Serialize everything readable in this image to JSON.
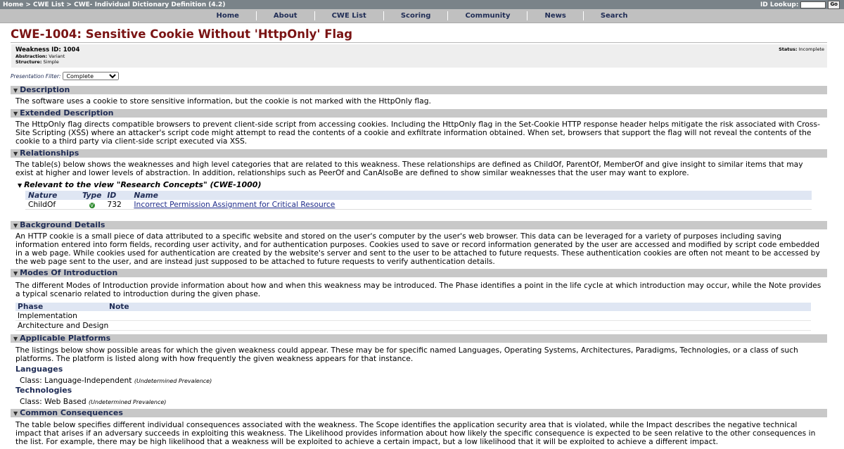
{
  "breadcrumb": "Home > CWE List > CWE- Individual Dictionary Definition (4.2)",
  "id_lookup": {
    "label": "ID Lookup:",
    "value": "",
    "go": "Go"
  },
  "nav": [
    "Home",
    "About",
    "CWE List",
    "Scoring",
    "Community",
    "News",
    "Search"
  ],
  "title": "CWE-1004: Sensitive Cookie Without 'HttpOnly' Flag",
  "weakness": {
    "id": "Weakness ID: 1004",
    "abstraction_label": "Abstraction:",
    "abstraction": "Variant",
    "structure_label": "Structure:",
    "structure": "Simple",
    "status_label": "Status:",
    "status": "Incomplete"
  },
  "filter": {
    "label": "Presentation Filter:",
    "value": "Complete",
    "options": [
      "Complete"
    ]
  },
  "sections": {
    "description": {
      "title": "Description",
      "text": "The software uses a cookie to store sensitive information, but the cookie is not marked with the HttpOnly flag."
    },
    "extended": {
      "title": "Extended Description",
      "text": "The HttpOnly flag directs compatible browsers to prevent client-side script from accessing cookies. Including the HttpOnly flag in the Set-Cookie HTTP response header helps mitigate the risk associated with Cross-Site Scripting (XSS) where an attacker's script code might attempt to read the contents of a cookie and exfiltrate information obtained. When set, browsers that support the flag will not reveal the contents of the cookie to a third party via client-side script executed via XSS."
    },
    "relationships": {
      "title": "Relationships",
      "text": "The table(s) below shows the weaknesses and high level categories that are related to this weakness. These relationships are defined as ChildOf, ParentOf, MemberOf and give insight to similar items that may exist at higher and lower levels of abstraction. In addition, relationships such as PeerOf and CanAlsoBe are defined to show similar weaknesses that the user may want to explore.",
      "view_title": "Relevant to the view \"Research Concepts\" (CWE-1000)",
      "columns": [
        "Nature",
        "Type",
        "ID",
        "Name"
      ],
      "rows": [
        {
          "nature": "ChildOf",
          "type": "V",
          "id": "732",
          "name": "Incorrect Permission Assignment for Critical Resource"
        }
      ]
    },
    "background": {
      "title": "Background Details",
      "text": "An HTTP cookie is a small piece of data attributed to a specific website and stored on the user's computer by the user's web browser. This data can be leveraged for a variety of purposes including saving information entered into form fields, recording user activity, and for authentication purposes. Cookies used to save or record information generated by the user are accessed and modified by script code embedded in a web page. While cookies used for authentication are created by the website's server and sent to the user to be attached to future requests. These authentication cookies are often not meant to be accessed by the web page sent to the user, and are instead just supposed to be attached to future requests to verify authentication details."
    },
    "modes": {
      "title": "Modes Of Introduction",
      "text": "The different Modes of Introduction provide information about how and when this weakness may be introduced. The Phase identifies a point in the life cycle at which introduction may occur, while the Note provides a typical scenario related to introduction during the given phase.",
      "columns": [
        "Phase",
        "Note"
      ],
      "rows": [
        "Implementation",
        "Architecture and Design"
      ]
    },
    "platforms": {
      "title": "Applicable Platforms",
      "text": "The listings below show possible areas for which the given weakness could appear. These may be for specific named Languages, Operating Systems, Architectures, Paradigms, Technologies, or a class of such platforms. The platform is listed along with how frequently the given weakness appears for that instance.",
      "languages_label": "Languages",
      "languages_class": "Class: Language-Independent",
      "languages_prev": "(Undetermined Prevalence)",
      "technologies_label": "Technologies",
      "technologies_class": "Class: Web Based",
      "technologies_prev": "(Undetermined Prevalence)"
    },
    "consequences": {
      "title": "Common Consequences",
      "text": "The table below specifies different individual consequences associated with the weakness. The Scope identifies the application security area that is violated, while the Impact describes the negative technical impact that arises if an adversary succeeds in exploiting this weakness. The Likelihood provides information about how likely the specific consequence is expected to be seen relative to the other consequences in the list. For example, there may be high likelihood that a weakness will be exploited to achieve a certain impact, but a low likelihood that it will be exploited to achieve a different impact."
    }
  }
}
